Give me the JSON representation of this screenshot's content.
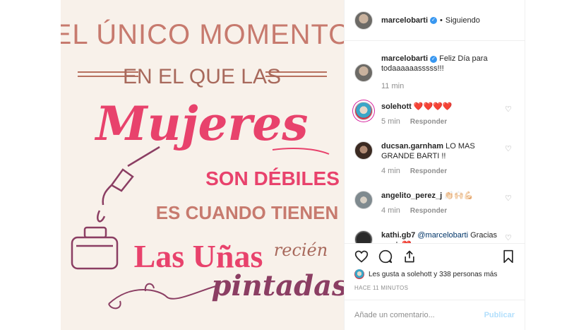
{
  "image": {
    "lines": [
      "EL ÚNICO MOMENTO",
      "EN EL QUE LAS",
      "Mujeres",
      "SON DÉBILES",
      "ES CUANDO TIENEN",
      "Las Uñas",
      "recién",
      "pintadas"
    ]
  },
  "post": {
    "author": "marcelobarti",
    "follow_state": "Siguiendo",
    "separator": "•"
  },
  "caption": {
    "author": "marcelobarti",
    "text": "Feliz Día para todaaaaaasssss!!!",
    "time": "11 min"
  },
  "comments": [
    {
      "user": "solehott",
      "text": "❤️❤️❤️❤️",
      "time": "5 min",
      "reply": "Responder"
    },
    {
      "user": "ducsan.garnham",
      "text": "LO MAS GRANDE BARTI !!",
      "time": "4 min",
      "reply": "Responder"
    },
    {
      "user": "angelito_perez_j",
      "text": "👏🏻🙌🏻💪🏻",
      "time": "4 min",
      "reply": "Responder"
    },
    {
      "user": "kathi.gb7",
      "mention": "@marcelobarti",
      "text": "Gracias crack ❤️",
      "time": "",
      "reply": ""
    }
  ],
  "likes": {
    "text": "Les gusta a solehott y 338 personas más"
  },
  "timestamp": "HACE 11 MINUTOS",
  "add_comment": {
    "placeholder": "Añade un comentario...",
    "publish": "Publicar"
  },
  "icons": {
    "like": "heart-icon",
    "comment": "comment-icon",
    "share": "share-icon",
    "save": "bookmark-icon",
    "verified": "verified-icon"
  },
  "colors": {
    "accent_pink": "#e8426c",
    "brown": "#a76a5c",
    "plum": "#8b3e63",
    "link_blue": "#3897f0",
    "publish_disabled": "#b2dffc"
  }
}
